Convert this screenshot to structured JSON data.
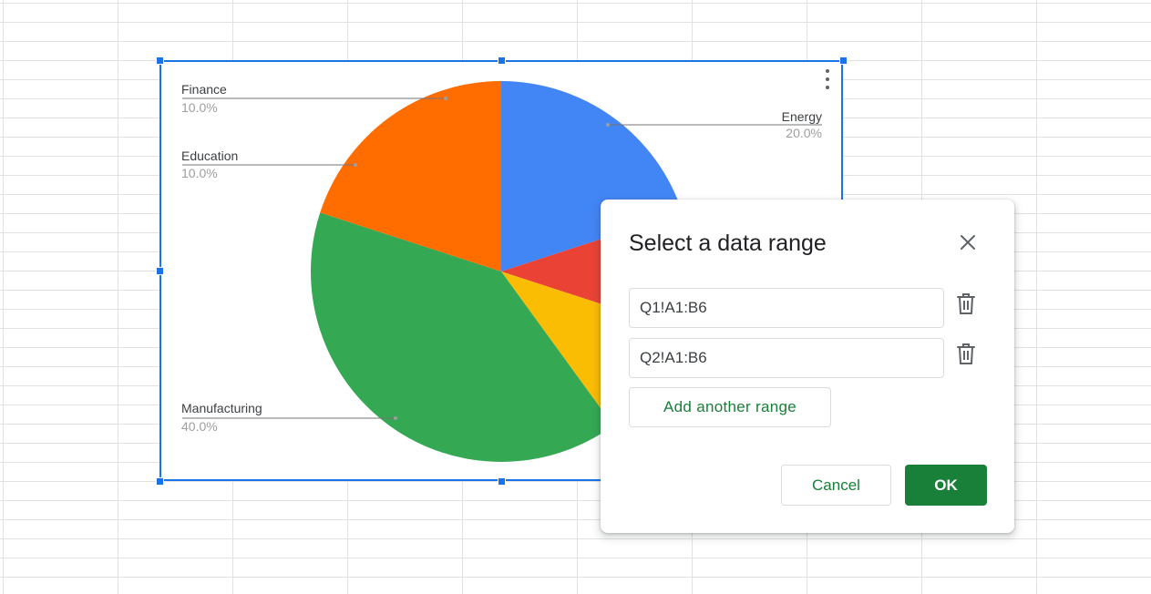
{
  "chart_data": {
    "type": "pie",
    "categories": [
      "Energy",
      "Finance",
      "Education",
      "Manufacturing",
      ""
    ],
    "values": [
      20,
      10,
      10,
      40,
      20
    ],
    "labels": [
      {
        "name": "Finance",
        "pct": "10.0%"
      },
      {
        "name": "Education",
        "pct": "10.0%"
      },
      {
        "name": "Manufacturing",
        "pct": "40.0%"
      },
      {
        "name": "Energy",
        "pct": "20.0%"
      }
    ],
    "colors": [
      "#4285f4",
      "#ea4335",
      "#fbbc04",
      "#34a853",
      "#ff6d01"
    ],
    "legend": "labels"
  },
  "chart_menu": {
    "icon": "more-vert-icon"
  },
  "dialog": {
    "title": "Select a data range",
    "close_icon": "close-icon",
    "ranges": [
      {
        "value": "Q1!A1:B6",
        "delete_icon": "trash-icon"
      },
      {
        "value": "Q2!A1:B6",
        "delete_icon": "trash-icon"
      }
    ],
    "add_range_label": "Add another range",
    "cancel_label": "Cancel",
    "ok_label": "OK",
    "accent_color": "#188038"
  }
}
